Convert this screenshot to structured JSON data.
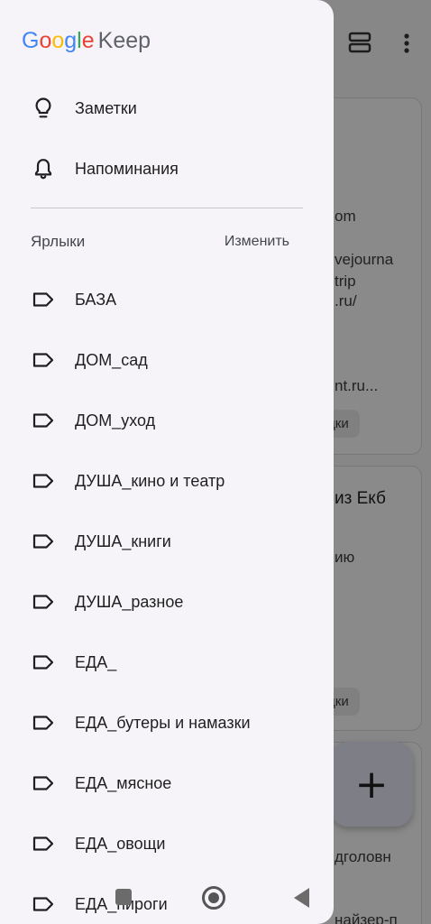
{
  "app": {
    "logo_google": [
      "G",
      "o",
      "o",
      "g",
      "l",
      "e"
    ],
    "logo_keep": "Keep"
  },
  "nav": {
    "notes_label": "Заметки",
    "reminders_label": "Напоминания"
  },
  "labels_section": {
    "title": "Ярлыки",
    "edit_label": "Изменить",
    "items": [
      "БАЗА",
      "ДОМ_сад",
      "ДОМ_уход",
      "ДУША_кино и театр",
      "ДУША_книги",
      "ДУША_разное",
      "ЕДА_",
      "ЕДА_бутеры и намазки",
      "ЕДА_мясное",
      "ЕДА_овощи",
      "ЕДА_пироги"
    ]
  },
  "background": {
    "card1_lines": [
      "om",
      "vejourna",
      "trip",
      ".ru/",
      "nt.ru..."
    ],
    "card1_chip": "дки",
    "card2_title": "из Екб",
    "card2_line": "ию",
    "card2_chip": "дки",
    "card3_lines": [
      "дголовн",
      "найзер-п"
    ]
  },
  "colors": {
    "drawer_bg": "#f6f4f9",
    "google_blue": "#4285f4",
    "google_red": "#ea4335",
    "google_yellow": "#fbbc05",
    "google_green": "#34a853"
  },
  "icons": {
    "notes": "lightbulb-icon",
    "reminders": "bell-icon",
    "label": "label-icon",
    "view_toggle": "view-toggle-icon",
    "more": "more-vert-icon",
    "fab": "plus-icon"
  }
}
